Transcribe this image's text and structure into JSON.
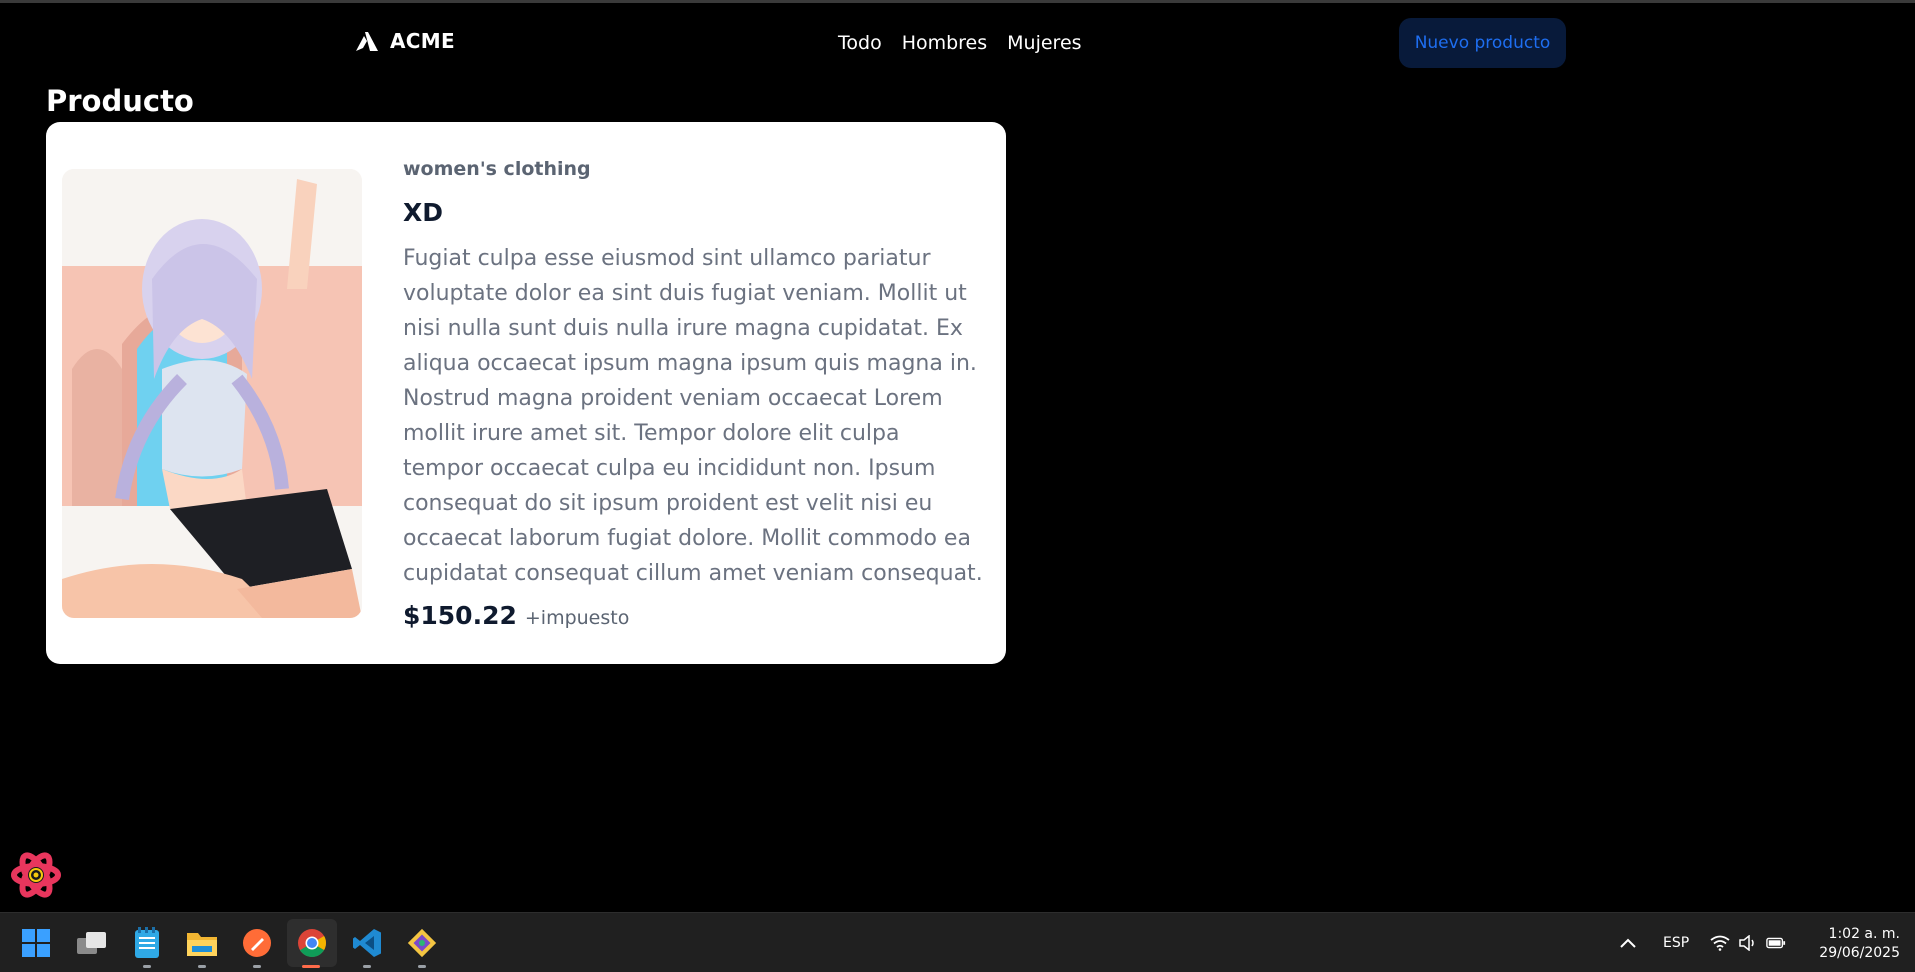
{
  "navbar": {
    "brand": "ACME",
    "links": [
      "Todo",
      "Hombres",
      "Mujeres"
    ],
    "new_product_label": "Nuevo producto"
  },
  "page": {
    "title": "Producto"
  },
  "product": {
    "category": "women's clothing",
    "name": "XD",
    "description": "Fugiat culpa esse eiusmod sint ullamco pariatur voluptate dolor ea sint duis fugiat veniam. Mollit ut nisi nulla sunt duis nulla irure magna cupidatat. Ex aliqua occaecat ipsum magna ipsum quis magna in. Nostrud magna proident veniam occaecat Lorem mollit irure amet sit. Tempor dolore elit culpa tempor occaecat culpa eu incididunt non. Ipsum consequat do sit ipsum proident est velit nisi eu occaecat laborum fugiat dolore. Mollit commodo ea cupidatat consequat cillum amet veniam consequat.",
    "price": "$150.22",
    "tax_note": "+impuesto",
    "image_icon": "product-illustration"
  },
  "taskbar": {
    "apps": [
      "windows-start-icon",
      "task-view-icon",
      "notepad-icon",
      "file-explorer-icon",
      "postman-icon",
      "chrome-icon",
      "vscode-icon",
      "git-icon"
    ],
    "tray": {
      "language": "ESP",
      "time": "1:02 a. m.",
      "date": "29/06/2025"
    }
  },
  "colors": {
    "background": "#000000",
    "card": "#ffffff",
    "accent": "#1e6ef0",
    "button_bg": "#081a3a"
  }
}
